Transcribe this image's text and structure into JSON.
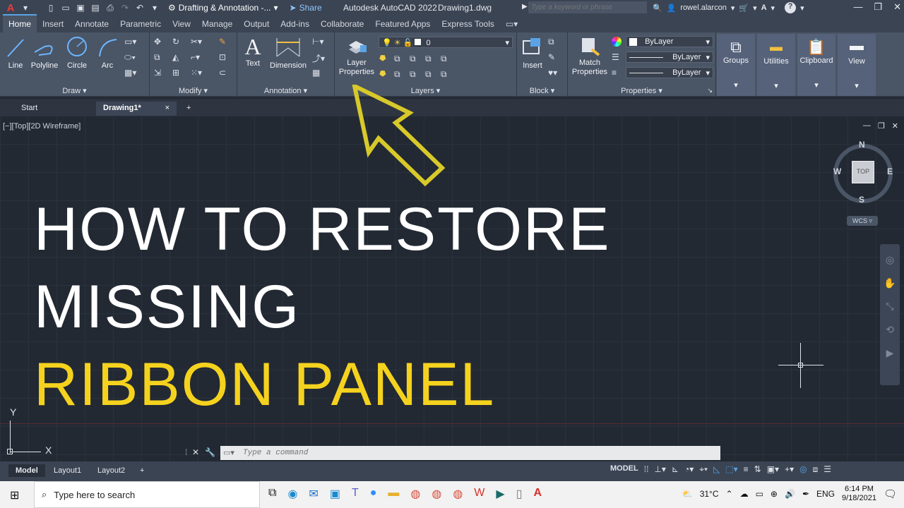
{
  "titlebar": {
    "app_menu_letter": "A",
    "workspace": "Drafting & Annotation -...",
    "share_label": "Share",
    "app_title": "Autodesk AutoCAD 2022",
    "doc_title": "Drawing1.dwg",
    "search_placeholder": "Type a keyword or phrase",
    "user": "rowel.alarcon",
    "help_label": "?"
  },
  "ribbon_tabs": [
    "Home",
    "Insert",
    "Annotate",
    "Parametric",
    "View",
    "Manage",
    "Output",
    "Add-ins",
    "Collaborate",
    "Featured Apps",
    "Express Tools"
  ],
  "ribbon": {
    "draw": {
      "title": "Draw",
      "line": "Line",
      "polyline": "Polyline",
      "circle": "Circle",
      "arc": "Arc"
    },
    "modify": {
      "title": "Modify"
    },
    "annotation": {
      "title": "Annotation",
      "text": "Text",
      "dimension": "Dimension"
    },
    "layers": {
      "title": "Layers",
      "layer_properties_1": "Layer",
      "layer_properties_2": "Properties",
      "current_layer": "0"
    },
    "block": {
      "title": "Block",
      "insert": "Insert"
    },
    "properties": {
      "title": "Properties",
      "match_1": "Match",
      "match_2": "Properties",
      "color": "ByLayer",
      "linetype": "ByLayer",
      "lineweight": "ByLayer"
    },
    "groups": "Groups",
    "utilities": "Utilities",
    "clipboard": "Clipboard",
    "view": "View"
  },
  "doc_tabs": {
    "start": "Start",
    "drawing": "Drawing1*",
    "close": "×",
    "new": "+"
  },
  "viewport": {
    "label": "[−][Top][2D Wireframe]"
  },
  "overlay": {
    "line1": "HOW  TO RESTORE",
    "line2": "MISSING",
    "line3": "RIBBON PANEL",
    "white": "#ffffff",
    "yellow": "#f5d21e",
    "arrow_color": "#d8c92a"
  },
  "viewcube": {
    "n": "N",
    "s": "S",
    "e": "E",
    "w": "W",
    "top": "TOP",
    "wcs": "WCS"
  },
  "ucs": {
    "x": "X",
    "y": "Y"
  },
  "command": {
    "placeholder": "Type a command"
  },
  "layout_tabs": [
    "Model",
    "Layout1",
    "Layout2"
  ],
  "status": {
    "model": "MODEL"
  },
  "taskbar": {
    "search": "Type here to search",
    "temp": "31°C",
    "lang": "ENG",
    "time": "6:14 PM",
    "date": "9/18/2021"
  }
}
